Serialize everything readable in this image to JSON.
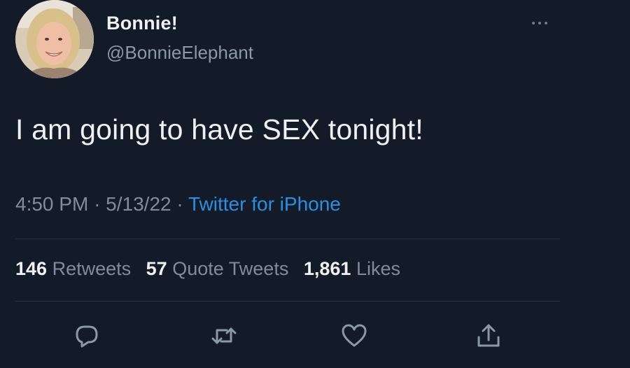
{
  "user": {
    "display_name": "Bonnie!",
    "handle": "@BonnieElephant"
  },
  "tweet": {
    "text": "I am going to have SEX tonight!",
    "time": "4:50 PM",
    "date": "5/13/22",
    "source": "Twitter for iPhone"
  },
  "stats": {
    "retweets_count": "146",
    "retweets_label": "Retweets",
    "quotes_count": "57",
    "quotes_label": "Quote Tweets",
    "likes_count": "1,861",
    "likes_label": "Likes"
  },
  "icons": {
    "more": "more-horizontal-icon",
    "reply": "reply-icon",
    "retweet": "retweet-icon",
    "like": "heart-icon",
    "share": "share-icon"
  },
  "colors": {
    "background": "#141b28",
    "link": "#2a8fe0",
    "muted": "#808c99"
  }
}
